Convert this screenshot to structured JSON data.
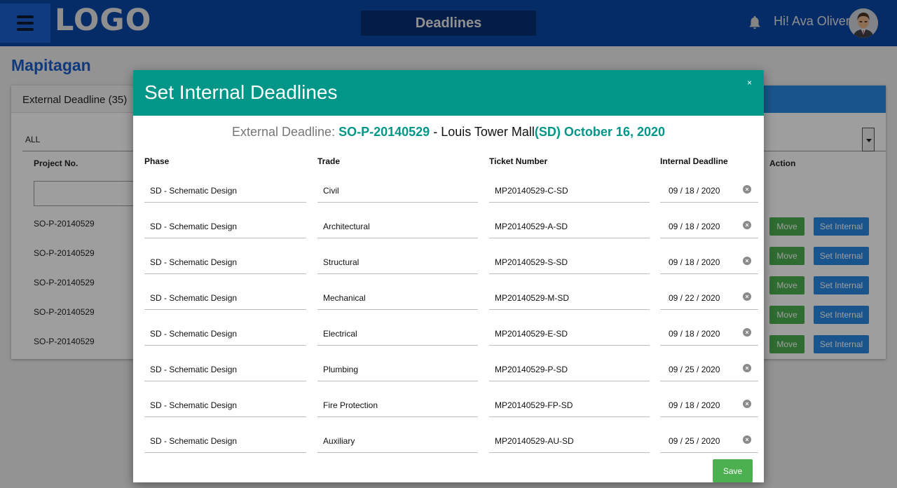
{
  "header": {
    "logo": "LOGO",
    "page_title": "Deadlines",
    "greeting": "Hi! Ava Oliver"
  },
  "background": {
    "title": "Mapitagan",
    "tab_label": "External Deadline (35)",
    "filter_value": "ALL",
    "col_project": "Project No.",
    "col_action": "Action",
    "rows": [
      {
        "project": "SO-P-20140529",
        "move": "Move",
        "set": "Set Internal"
      },
      {
        "project": "SO-P-20140529",
        "move": "Move",
        "set": "Set Internal"
      },
      {
        "project": "SO-P-20140529",
        "move": "Move",
        "set": "Set Internal"
      },
      {
        "project": "SO-P-20140529",
        "move": "Move",
        "set": "Set Internal"
      },
      {
        "project": "SO-P-20140529",
        "move": "Move",
        "set": "Set Internal"
      }
    ]
  },
  "modal": {
    "title": "Set Internal Deadlines",
    "close": "×",
    "sub_label": "External Deadline:",
    "sub_project": "SO-P-20140529",
    "sub_sep": " - ",
    "sub_name": "Louis Tower Mall",
    "sub_date": "(SD) October 16, 2020",
    "columns": {
      "phase": "Phase",
      "trade": "Trade",
      "ticket": "Ticket Number",
      "deadline": "Internal Deadline"
    },
    "rows": [
      {
        "phase": "SD - Schematic Design",
        "trade": "Civil",
        "ticket": "MP20140529-C-SD",
        "deadline": "09 / 18 / 2020"
      },
      {
        "phase": "SD - Schematic Design",
        "trade": "Architectural",
        "ticket": "MP20140529-A-SD",
        "deadline": "09 / 18 / 2020"
      },
      {
        "phase": "SD - Schematic Design",
        "trade": "Structural",
        "ticket": "MP20140529-S-SD",
        "deadline": "09 / 18 / 2020"
      },
      {
        "phase": "SD - Schematic Design",
        "trade": "Mechanical",
        "ticket": "MP20140529-M-SD",
        "deadline": "09 / 22 / 2020"
      },
      {
        "phase": "SD - Schematic Design",
        "trade": "Electrical",
        "ticket": "MP20140529-E-SD",
        "deadline": "09 / 18 / 2020"
      },
      {
        "phase": "SD - Schematic Design",
        "trade": "Plumbing",
        "ticket": "MP20140529-P-SD",
        "deadline": "09 / 25 / 2020"
      },
      {
        "phase": "SD - Schematic Design",
        "trade": "Fire Protection",
        "ticket": "MP20140529-FP-SD",
        "deadline": "09 / 18 / 2020"
      },
      {
        "phase": "SD - Schematic Design",
        "trade": "Auxiliary",
        "ticket": "MP20140529-AU-SD",
        "deadline": "09 / 25 / 2020"
      }
    ],
    "save_label": "Save"
  },
  "colors": {
    "header_bg": "#0a47a9",
    "modal_header": "#009688",
    "move_button": "#4caf50",
    "set_internal_button": "#2b88e3"
  }
}
